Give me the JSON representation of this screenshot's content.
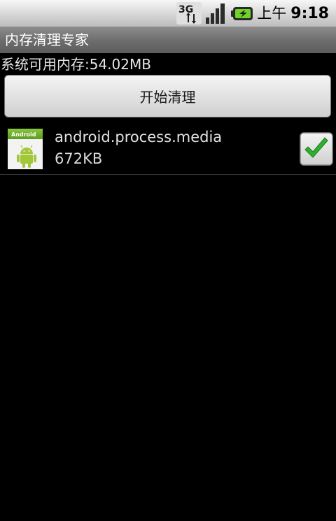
{
  "status_bar": {
    "network_type": "3G",
    "signal_icon": "signal-strength-icon",
    "battery_icon": "battery-charging-icon",
    "clock_ampm": "上午",
    "clock_time": "9:18"
  },
  "title_bar": {
    "title": "内存清理专家"
  },
  "memory": {
    "available_text": "系统可用内存:54.02MB"
  },
  "actions": {
    "start_label": "开始清理"
  },
  "process_list": [
    {
      "icon": "android-app-icon",
      "icon_text": "Android",
      "name": "android.process.media",
      "size": "672KB",
      "checked": true
    }
  ],
  "colors": {
    "background": "#000000",
    "checkmark": "#2fb02f",
    "android_green": "#a4c639"
  }
}
